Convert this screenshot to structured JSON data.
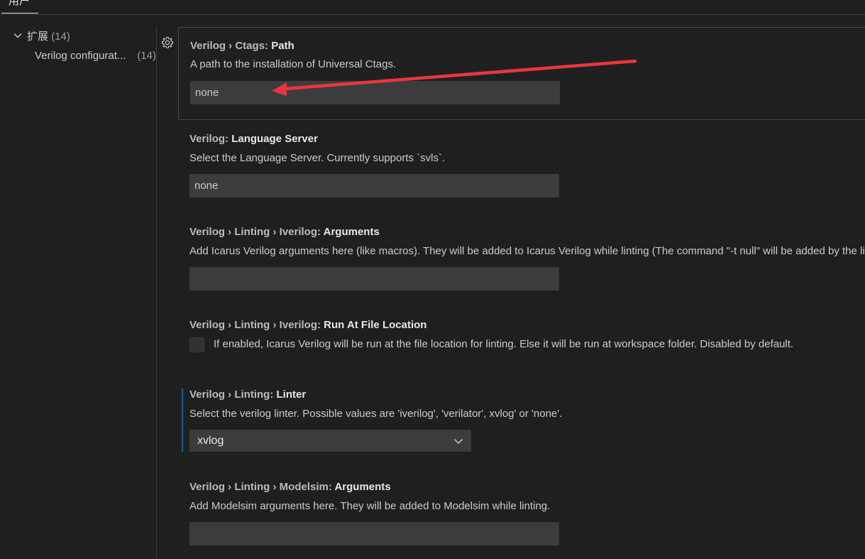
{
  "scope_tab": {
    "label": "用户"
  },
  "toc": {
    "extensions": {
      "label": "扩展",
      "count": "(14)"
    },
    "verilog": {
      "label": "Verilog configurat...",
      "count": "(14)"
    }
  },
  "settings": [
    {
      "category": "Verilog › Ctags: ",
      "key": "Path",
      "description": "A path to the installation of Universal Ctags.",
      "value": "none"
    },
    {
      "category": "Verilog: ",
      "key": "Language Server",
      "description": "Select the Language Server. Currently supports `svls`.",
      "value": "none"
    },
    {
      "category": "Verilog › Linting › Iverilog: ",
      "key": "Arguments",
      "description": "Add Icarus Verilog arguments here (like macros). They will be added to Icarus Verilog while linting (The command \"-t null\" will be added by the linter by default).",
      "value": ""
    },
    {
      "category": "Verilog › Linting › Iverilog: ",
      "key": "Run At File Location",
      "description": "If enabled, Icarus Verilog will be run at the file location for linting. Else it will be run at workspace folder. Disabled by default.",
      "checked": false
    },
    {
      "category": "Verilog › Linting: ",
      "key": "Linter",
      "description": "Select the verilog linter. Possible values are 'iverilog', 'verilator', xvlog' or 'none'.",
      "selected": "xvlog"
    },
    {
      "category": "Verilog › Linting › Modelsim: ",
      "key": "Arguments",
      "description": "Add Modelsim arguments here. They will be added to Modelsim while linting.",
      "value": ""
    }
  ],
  "colors": {
    "background": "#1f1f1f",
    "input_background": "#3c3c3c",
    "modified_indicator": "#0e639c",
    "annotation_arrow": "#e8383d"
  },
  "icons": [
    "chevron-down-icon",
    "gear-icon",
    "select-chevron-icon"
  ]
}
